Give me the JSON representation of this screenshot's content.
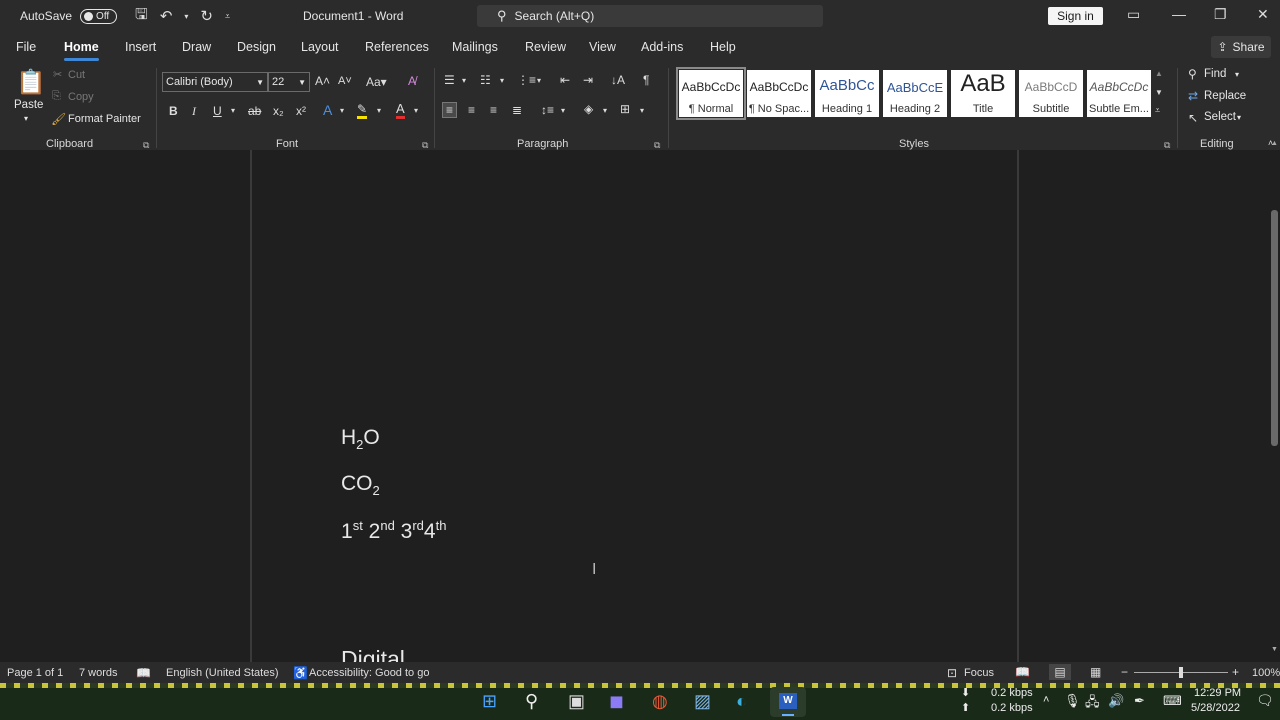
{
  "titlebar": {
    "autosave_label": "AutoSave",
    "autosave_state": "Off",
    "doc_title": "Document1 - Word",
    "search_placeholder": "Search (Alt+Q)",
    "signin_label": "Sign in"
  },
  "tabs": [
    "File",
    "Home",
    "Insert",
    "Draw",
    "Design",
    "Layout",
    "References",
    "Mailings",
    "Review",
    "View",
    "Add-ins",
    "Help"
  ],
  "share_label": "Share",
  "clipboard": {
    "paste": "Paste",
    "cut": "Cut",
    "copy": "Copy",
    "format_painter": "Format Painter",
    "label": "Clipboard"
  },
  "font": {
    "name": "Calibri (Body)",
    "size": "22",
    "label": "Font"
  },
  "paragraph": {
    "label": "Paragraph"
  },
  "styles": {
    "label": "Styles",
    "items": [
      {
        "sample": "AaBbCcDc",
        "name": "¶ Normal"
      },
      {
        "sample": "AaBbCcDc",
        "name": "¶ No Spac..."
      },
      {
        "sample": "AaBbCc",
        "name": "Heading 1"
      },
      {
        "sample": "AaBbCcE",
        "name": "Heading 2"
      },
      {
        "sample": "AaB",
        "name": "Title"
      },
      {
        "sample": "AaBbCcD",
        "name": "Subtitle"
      },
      {
        "sample": "AaBbCcDc",
        "name": "Subtle Em..."
      }
    ]
  },
  "editing": {
    "find": "Find",
    "replace": "Replace",
    "select": "Select",
    "label": "Editing"
  },
  "document": {
    "line1_main": "H",
    "line1_sub": "2",
    "line1_end": "O",
    "line2_main": "CO",
    "line2_sub": "2",
    "line3": [
      {
        "n": "1",
        "s": "st"
      },
      {
        "n": "2",
        "s": "nd"
      },
      {
        "n": "3",
        "s": "rd"
      },
      {
        "n": "4",
        "s": "th"
      }
    ],
    "line4": "Digital"
  },
  "status": {
    "page": "Page 1 of 1",
    "words": "7 words",
    "language": "English (United States)",
    "accessibility": "Accessibility: Good to go",
    "focus": "Focus",
    "zoom": "100%"
  },
  "tray": {
    "down": "0.2 kbps",
    "up": "0.2 kbps",
    "time": "12:29 PM",
    "date": "5/28/2022"
  }
}
